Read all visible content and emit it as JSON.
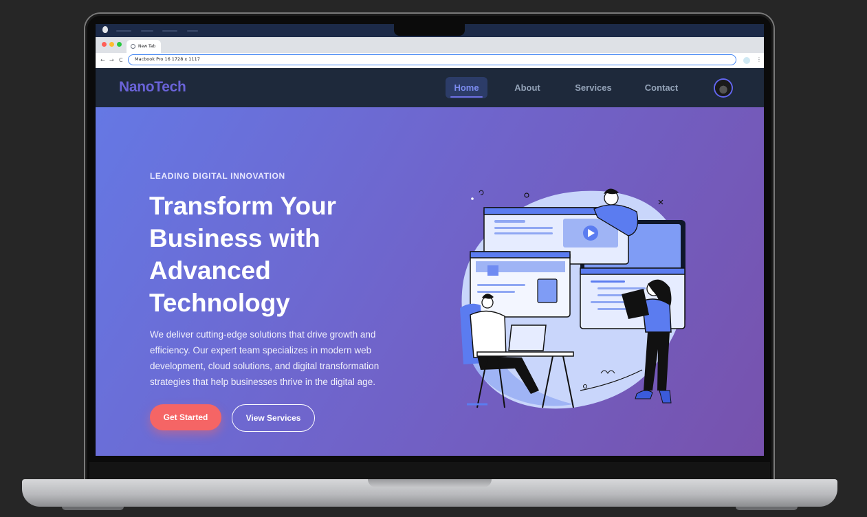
{
  "browser": {
    "tab_title": "New Tab",
    "address": "Macbook Pro 16  1728 x 1117",
    "back_glyph": "←",
    "forward_glyph": "→",
    "reload_glyph": "C",
    "menu_glyph": "⋮"
  },
  "site": {
    "logo": "NanoTech",
    "nav": [
      {
        "label": "Home",
        "active": true
      },
      {
        "label": "About",
        "active": false
      },
      {
        "label": "Services",
        "active": false
      },
      {
        "label": "Contact",
        "active": false
      }
    ]
  },
  "hero": {
    "eyebrow": "LEADING DIGITAL INNOVATION",
    "headline": "Transform Your Business with Advanced Technology",
    "description": "We deliver cutting-edge solutions that drive growth and efficiency. Our expert team specializes in modern web development, cloud solutions, and digital transformation strategies that help businesses thrive in the digital age.",
    "primary_cta": "Get Started",
    "secondary_cta": "View Services"
  },
  "colors": {
    "nav_bg": "#1e293b",
    "logo": "#6a63d8",
    "hero_gradient_start": "#6578e4",
    "hero_gradient_end": "#7752ad",
    "primary_button": "#f56565"
  },
  "icons": {
    "avatar": "user-avatar",
    "illustration": "team-web-development-illustration"
  }
}
